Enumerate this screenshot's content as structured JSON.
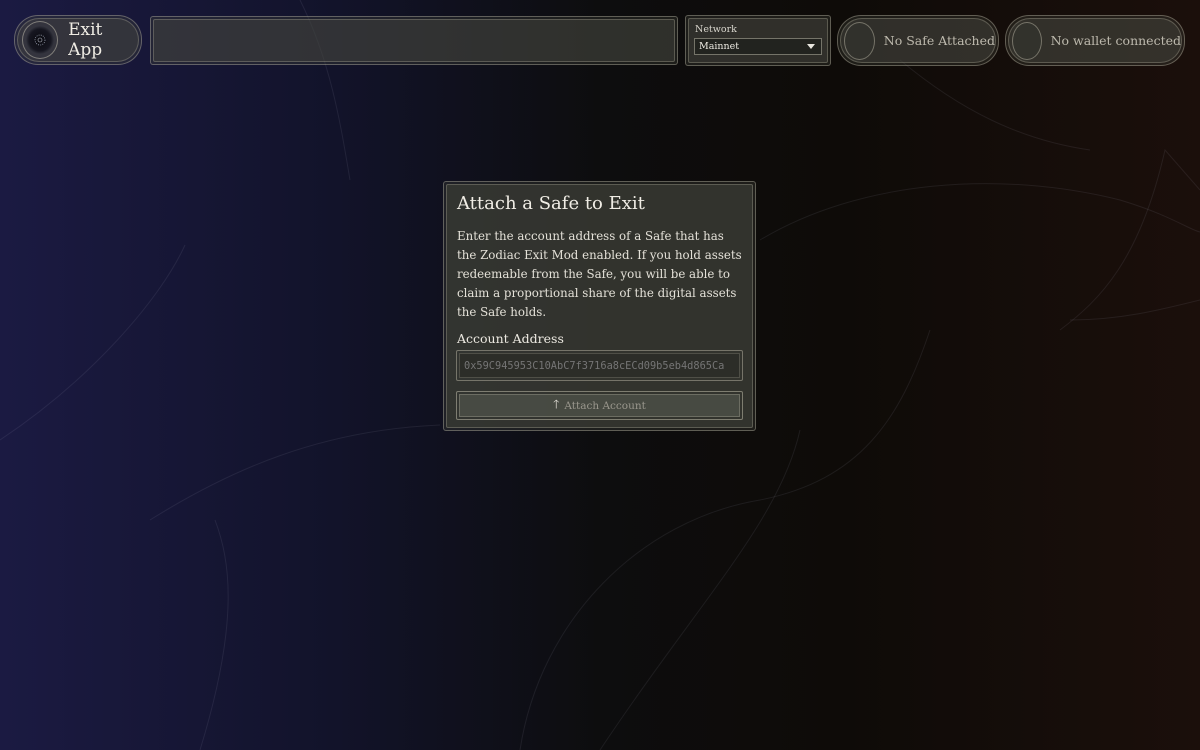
{
  "header": {
    "app_title": "Exit App",
    "network": {
      "label": "Network",
      "selected": "Mainnet"
    },
    "safe_status": "No Safe Attached",
    "wallet_status": "No wallet connected"
  },
  "dialog": {
    "title": "Attach a Safe to Exit",
    "description": "Enter the account address of a Safe that has the Zodiac Exit Mod enabled. If you hold assets redeemable from the Safe, you will be able to claim a proportional share of the digital assets the Safe holds.",
    "account_label": "Account Address",
    "account_placeholder": "0x59C945953C10AbC7f3716a8cECd09b5eb4d865Ca",
    "attach_button": "Attach Account"
  },
  "icons": {
    "logo": "zodiac-logo-icon",
    "network_caret": "chevron-down-icon",
    "attach": "arrow-up-icon"
  }
}
